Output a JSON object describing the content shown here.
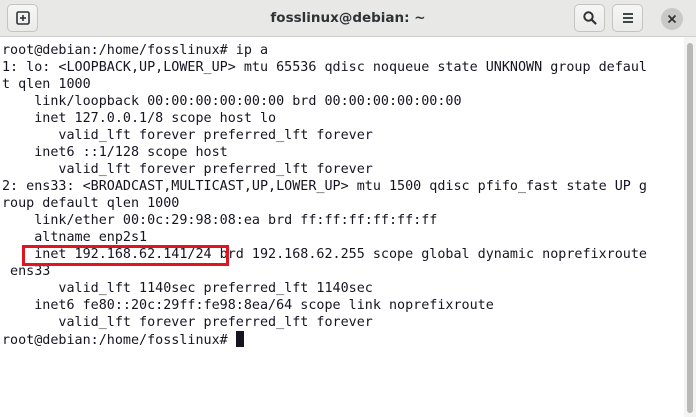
{
  "window": {
    "title": "fosslinux@debian: ~",
    "icons": {
      "new_tab": "new-tab-icon",
      "search": "search-icon",
      "menu": "hamburger-menu-icon",
      "close": "close-icon"
    }
  },
  "terminal": {
    "lines": [
      "root@debian:/home/fosslinux# ip a",
      "1: lo: <LOOPBACK,UP,LOWER_UP> mtu 65536 qdisc noqueue state UNKNOWN group defaul",
      "t qlen 1000",
      "    link/loopback 00:00:00:00:00:00 brd 00:00:00:00:00:00",
      "    inet 127.0.0.1/8 scope host lo",
      "       valid_lft forever preferred_lft forever",
      "    inet6 ::1/128 scope host",
      "       valid_lft forever preferred_lft forever",
      "2: ens33: <BROADCAST,MULTICAST,UP,LOWER_UP> mtu 1500 qdisc pfifo_fast state UP g",
      "roup default qlen 1000",
      "    link/ether 00:0c:29:98:08:ea brd ff:ff:ff:ff:ff:ff",
      "    altname enp2s1",
      "    inet 192.168.62.141/24 brd 192.168.62.255 scope global dynamic noprefixroute",
      " ens33",
      "       valid_lft 1140sec preferred_lft 1140sec",
      "    inet6 fe80::20c:29ff:fe98:8ea/64 scope link noprefixroute",
      "       valid_lft forever preferred_lft forever",
      "root@debian:/home/fosslinux# "
    ],
    "highlighted_text": "inet 192.168.62.141/24"
  },
  "colors": {
    "highlight_border": "#e0151f",
    "terminal_text": "#171421",
    "titlebar_bg": "#e8e8e7"
  }
}
